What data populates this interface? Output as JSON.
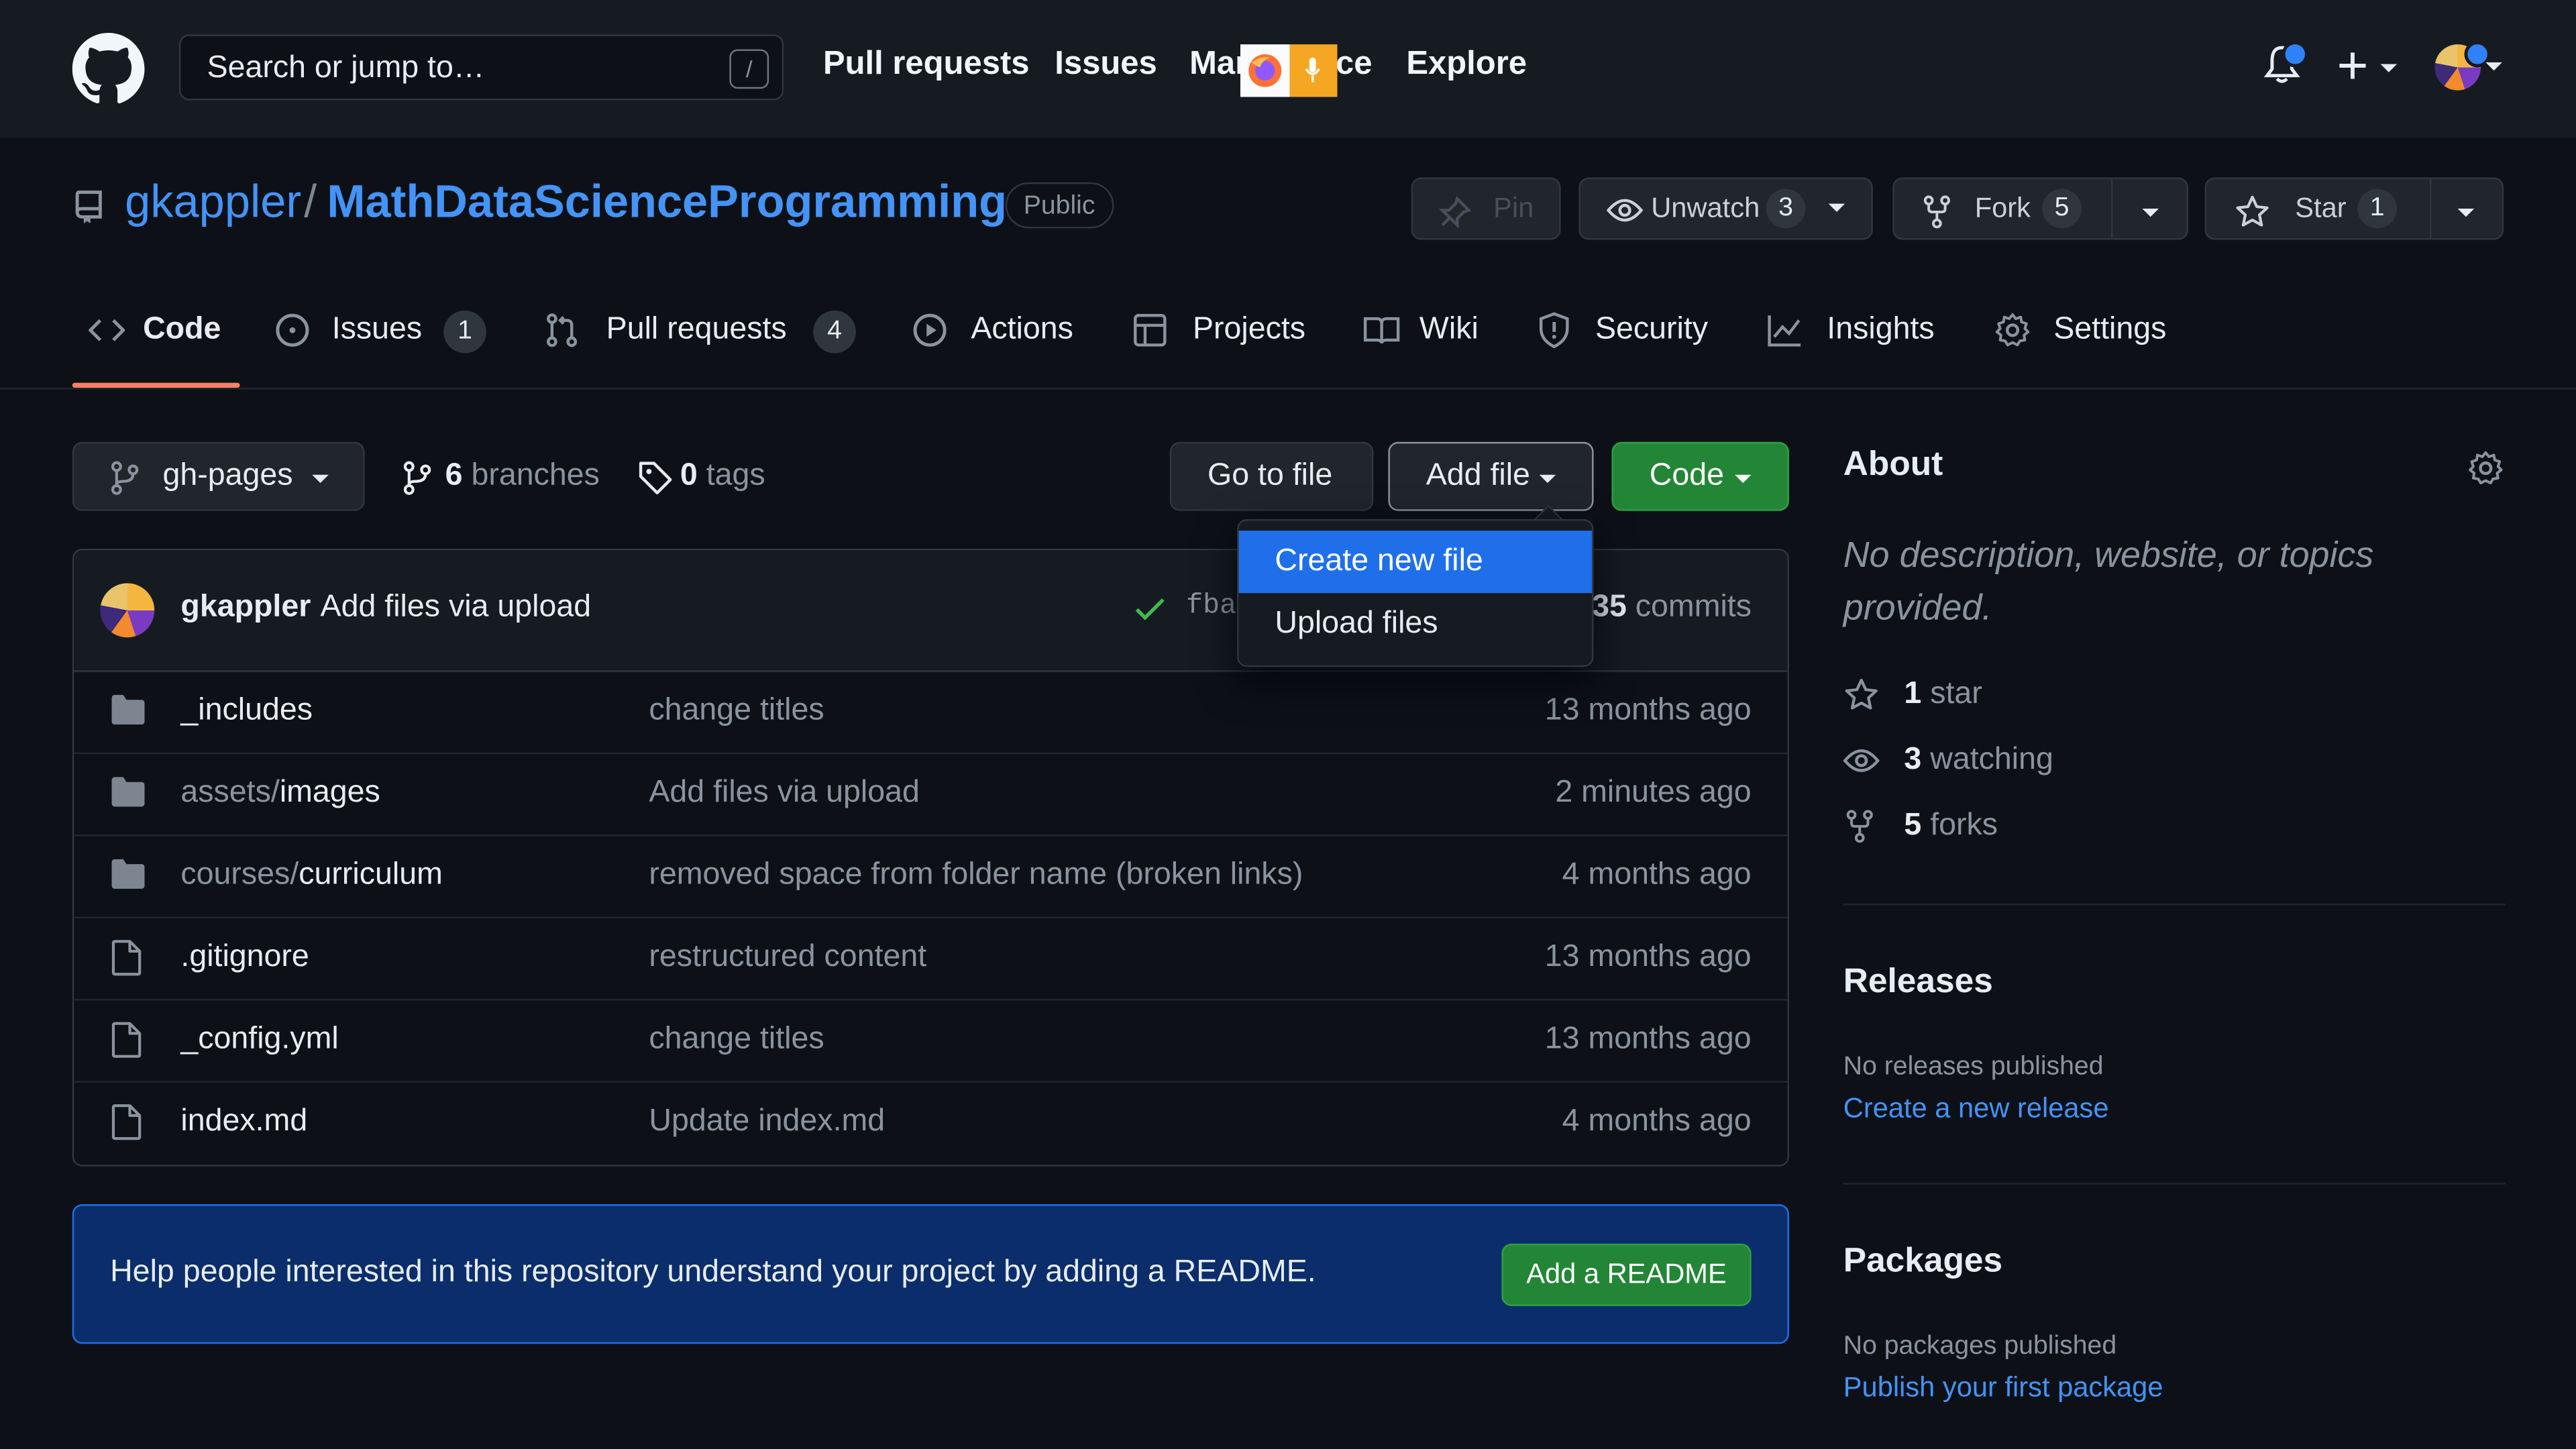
{
  "header": {
    "search_placeholder": "Search or jump to…",
    "search_shortcut": "/",
    "nav": [
      "Pull requests",
      "Issues",
      "Mar",
      "ce",
      "Explore"
    ]
  },
  "repo": {
    "owner": "gkappler",
    "separator": "/",
    "name": "MathDataScienceProgramming",
    "visibility": "Public",
    "pin_label": "Pin",
    "unwatch_label": "Unwatch",
    "unwatch_count": "3",
    "fork_label": "Fork",
    "fork_count": "5",
    "star_label": "Star",
    "star_count": "1"
  },
  "tabs": [
    {
      "label": "Code"
    },
    {
      "label": "Issues",
      "count": "1"
    },
    {
      "label": "Pull requests",
      "count": "4"
    },
    {
      "label": "Actions"
    },
    {
      "label": "Projects"
    },
    {
      "label": "Wiki"
    },
    {
      "label": "Security"
    },
    {
      "label": "Insights"
    },
    {
      "label": "Settings"
    }
  ],
  "filenav": {
    "branch": "gh-pages",
    "branches_count": "6",
    "branches_label": "branches",
    "tags_count": "0",
    "tags_label": "tags",
    "goto_file": "Go to file",
    "add_file": "Add file",
    "code": "Code"
  },
  "dropdown": {
    "items": [
      "Create new file",
      "Upload files"
    ]
  },
  "commit": {
    "author": "gkappler",
    "message": "Add files via upload",
    "sha_partial": "fba",
    "commits_count": "35",
    "commits_label": "commits"
  },
  "files": [
    {
      "type": "dir",
      "name": "_includes",
      "name_prefix": "",
      "message": "change titles",
      "age": "13 months ago"
    },
    {
      "type": "dir",
      "name": "images",
      "name_prefix": "assets/",
      "message": "Add files via upload",
      "age": "2 minutes ago"
    },
    {
      "type": "dir",
      "name": "curriculum",
      "name_prefix": "courses/",
      "message": "removed space from folder name (broken links)",
      "age": "4 months ago"
    },
    {
      "type": "file",
      "name": ".gitignore",
      "name_prefix": "",
      "message": "restructured content",
      "age": "13 months ago"
    },
    {
      "type": "file",
      "name": "_config.yml",
      "name_prefix": "",
      "message": "change titles",
      "age": "13 months ago"
    },
    {
      "type": "file",
      "name": "index.md",
      "name_prefix": "",
      "message": "Update index.md",
      "age": "4 months ago"
    }
  ],
  "readme": {
    "text": "Help people interested in this repository understand your project by adding a README.",
    "button": "Add a README"
  },
  "about": {
    "title": "About",
    "description": "No description, website, or topics provided.",
    "stars_count": "1",
    "stars_label": "star",
    "watching_count": "3",
    "watching_label": "watching",
    "forks_count": "5",
    "forks_label": "forks"
  },
  "releases": {
    "title": "Releases",
    "none_text": "No releases published",
    "link": "Create a new release"
  },
  "packages": {
    "title": "Packages",
    "none_text": "No packages published",
    "link": "Publish your first package"
  },
  "colors": {
    "background": "#0d1117",
    "header_bg": "#161b22",
    "link": "#4493f8",
    "green_button": "#238636",
    "selected_item": "#1f6feb",
    "tab_underline": "#f78166",
    "readme_banner": "#0c2d6b"
  },
  "icons": [
    "github-logo-icon",
    "bell-icon",
    "plus-icon",
    "repo-icon",
    "pin-icon",
    "eye-icon",
    "fork-icon",
    "star-icon",
    "code-icon",
    "issue-icon",
    "pull-request-icon",
    "play-icon",
    "table-icon",
    "book-icon",
    "shield-icon",
    "graph-icon",
    "gear-icon",
    "branch-icon",
    "tag-icon",
    "check-icon",
    "folder-icon",
    "file-icon",
    "firefox-icon",
    "microphone-icon"
  ]
}
